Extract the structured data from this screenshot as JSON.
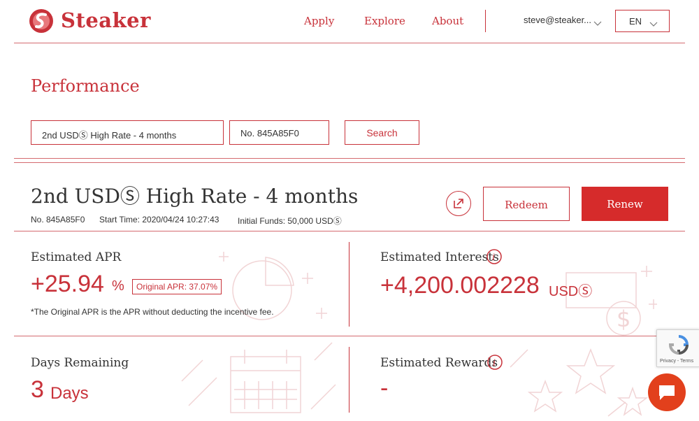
{
  "header": {
    "brand": "Steaker",
    "nav": [
      "Apply",
      "Explore",
      "About"
    ],
    "user": "steve@steaker...",
    "language": "EN"
  },
  "performance": {
    "title": "Performance",
    "product_select": "2nd USDⓈ High Rate - 4 months",
    "order_number": "No. 845A85F0",
    "search_label": "Search"
  },
  "product": {
    "title": "2nd USDⓈ High Rate - 4 months",
    "number": "No. 845A85F0",
    "start_time": "Start Time: 2020/04/24 10:27:43",
    "initial_funds": "Initial Funds: 50,000 USDⓈ",
    "redeem_label": "Redeem",
    "renew_label": "Renew"
  },
  "stats": {
    "apr_label": "Estimated APR",
    "apr_value": "+25.94",
    "apr_unit": "%",
    "original_apr": "Original APR: 37.07%",
    "apr_note": "*The Original APR is the APR without deducting the incentive fee.",
    "interests_label": "Estimated Interests",
    "interests_value": "+4,200.002228",
    "interests_unit": "USDⓈ",
    "days_label": "Days Remaining",
    "days_value": "3",
    "days_unit": "Days",
    "rewards_label": "Estimated Rewards",
    "rewards_value": "-"
  },
  "recaptcha": {
    "text": "Privacy - Terms"
  },
  "colors": {
    "brand": "#c8323a",
    "renew_button": "#d62b2b",
    "chat_button": "#e2401c"
  },
  "icons": [
    "logo-icon",
    "chevron-down-icon",
    "external-link-icon",
    "info-icon",
    "pie-chart-icon",
    "dollar-bill-icon",
    "calendar-icon",
    "star-icon",
    "recaptcha-icon",
    "chat-icon"
  ]
}
